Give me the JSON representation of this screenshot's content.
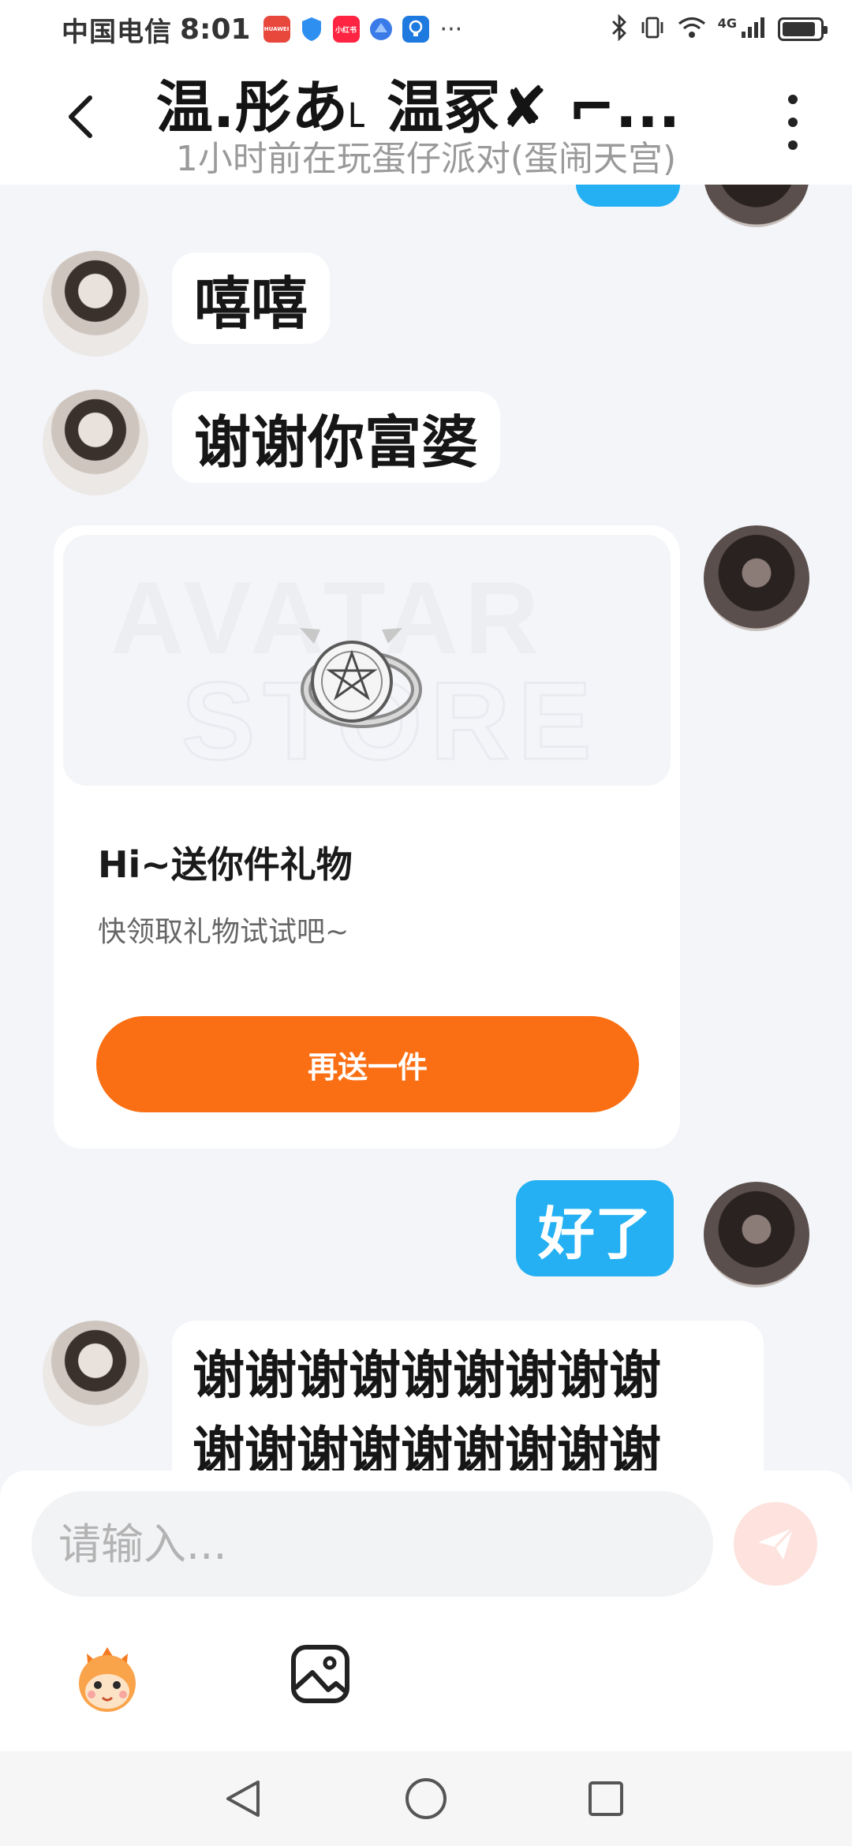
{
  "status_bar": {
    "carrier": "中国电信",
    "time": "8:01",
    "apps": [
      {
        "name": "huawei-appgallery-icon",
        "label": "HUAWEI",
        "color": "#e8473c"
      },
      {
        "name": "shield-app-icon",
        "label": "",
        "color": "#2f8ff0"
      },
      {
        "name": "xiaohongshu-icon",
        "label": "小红书",
        "color": "#ff2442"
      },
      {
        "name": "browser-app-icon",
        "label": "",
        "color": "#3a7be8"
      },
      {
        "name": "bulb-app-icon",
        "label": "",
        "color": "#1f7ae0"
      }
    ],
    "overflow": "···",
    "network_label": "4G",
    "battery_level": 0.9
  },
  "header": {
    "title": "温.彤あ˪ 温冢✘ ⌐...",
    "subtitle": "1小时前在玩蛋仔派对(蛋闹天宫)"
  },
  "messages": [
    {
      "side": "left",
      "text": "嘻嘻"
    },
    {
      "side": "left",
      "text": "谢谢你富婆"
    },
    {
      "side": "right",
      "type": "gift_card"
    },
    {
      "side": "right",
      "text": "好了"
    },
    {
      "side": "left",
      "text": "谢谢谢谢谢谢谢谢谢\n谢谢谢谢谢谢谢谢谢"
    }
  ],
  "gift_card": {
    "watermark_line1": "AVATAR",
    "watermark_line2": "STORE",
    "title": "Hi~送你件礼物",
    "description": "快领取礼物试试吧~",
    "button_label": "再送一件"
  },
  "input": {
    "placeholder": "请输入...",
    "value": ""
  },
  "colors": {
    "bubble_right": "#24b0f2",
    "gift_button": "#fb6f14",
    "background": "#f3f5f9"
  }
}
